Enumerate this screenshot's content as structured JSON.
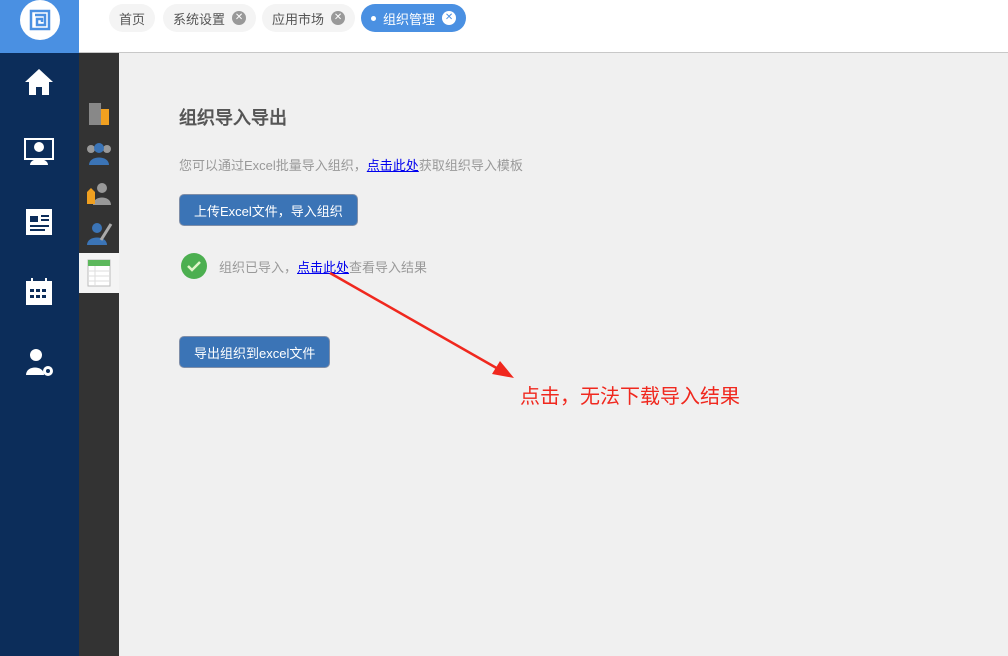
{
  "tabs": [
    {
      "label": "首页",
      "closable": false
    },
    {
      "label": "系统设置",
      "closable": true
    },
    {
      "label": "应用市场",
      "closable": true
    },
    {
      "label": "组织管理",
      "closable": true,
      "active": true
    }
  ],
  "main": {
    "title": "组织导入导出",
    "desc_prefix": "您可以通过Excel批量导入组织，",
    "desc_link": "点击此处",
    "desc_suffix": "获取组织导入模板",
    "upload_button": "上传Excel文件，导入组织",
    "status_prefix": "组织已导入，",
    "status_link": "点击此处",
    "status_suffix": "查看导入结果",
    "export_button": "导出组织到excel文件"
  },
  "annotation": "点击，无法下载导入结果",
  "colors": {
    "accent": "#4a90e2",
    "sidebar": "#0c2d5a",
    "annotation": "#f0281e"
  }
}
